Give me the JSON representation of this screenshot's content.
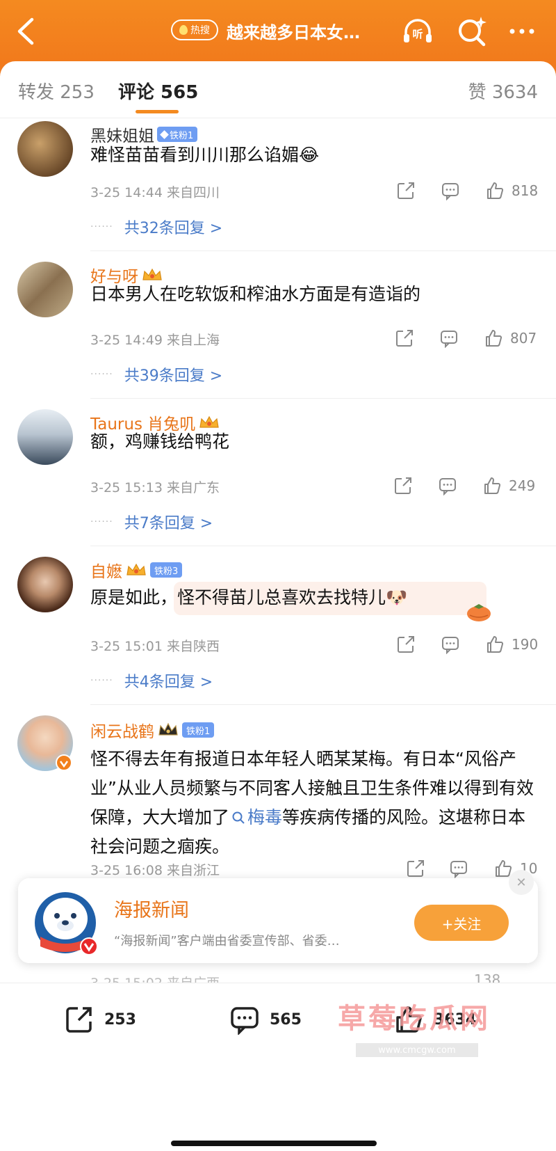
{
  "header": {
    "hot_label": "热搜",
    "title": "越来越多日本女…",
    "listen_label": "听"
  },
  "tabs": {
    "repost": "转发 253",
    "comments": "评论 565",
    "likes": "赞 3634"
  },
  "comments": [
    {
      "name": "黑妹姐姐",
      "badge": "铁粉1",
      "text": "难怪苗苗看到川川那么谄媚😂",
      "meta": "3-25 14:44  来自四川",
      "likes": "818",
      "replies": "共32条回复 >"
    },
    {
      "name": "好与呀",
      "text": "日本男人在吃软饭和榨油水方面是有造诣的",
      "meta": "3-25 14:49  来自上海",
      "likes": "807",
      "replies": "共39条回复 >"
    },
    {
      "name": "Taurus 肖兔叽",
      "text": "额，鸡赚钱给鸭花",
      "meta": "3-25 15:13  来自广东",
      "likes": "249",
      "replies": "共7条回复 >"
    },
    {
      "name": "自嬷",
      "badge": "铁粉3",
      "text": "原是如此，怪不得苗儿总喜欢去找特儿🐶",
      "meta": "3-25 15:01  来自陕西",
      "likes": "190",
      "replies": "共4条回复 >"
    },
    {
      "name": "闲云战鹤",
      "badge": "铁粉1",
      "text_before": "怪不得去年有报道日本年轻人晒某某梅。有日本“风俗产业”从业人员频繁与不同客人接触且卫生条件难以得到有效保障，大大增加了",
      "topic": "梅毒",
      "text_after": "等疾病传播的风险。这堪称日本社会问题之痼疾。",
      "meta": "3-25 16:08  来自浙江",
      "likes": "10"
    }
  ],
  "follow_card": {
    "name": "海报新闻",
    "desc": "“海报新闻”客户端由省委宣传部、省委…",
    "button": "+关注"
  },
  "peek": {
    "meta": "3-25 15:02  来自广西",
    "likes": "138"
  },
  "bottom_bar": {
    "repost_count": "253",
    "comment_count": "565",
    "like_count": "3634"
  },
  "watermark": {
    "text": "草莓吃瓜网",
    "sub": "www.cmcgw.com"
  },
  "colors": {
    "header": "#f27a1c",
    "accent": "#e8751a",
    "link": "#4a7bc8",
    "fan_badge": "#6e9df2"
  }
}
